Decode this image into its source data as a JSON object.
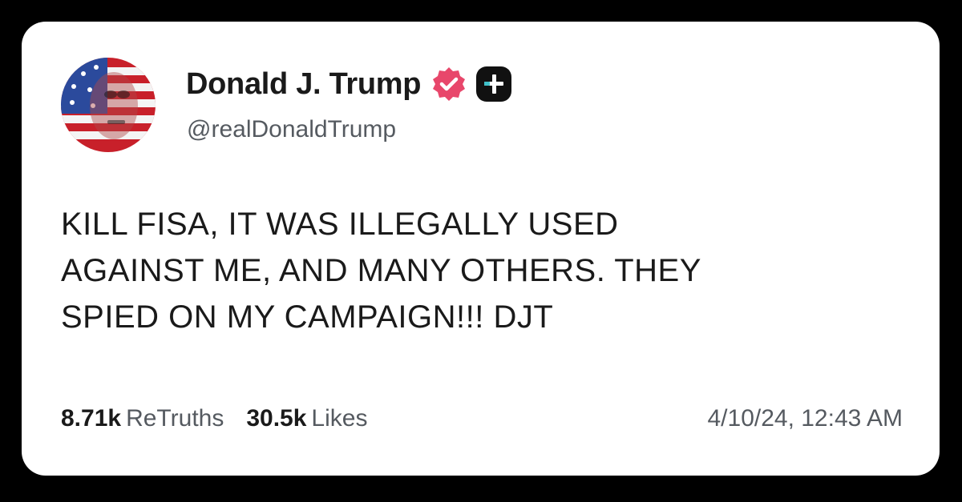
{
  "post": {
    "author": {
      "display_name": "Donald J. Trump",
      "handle": "@realDonaldTrump",
      "avatar_icon": "flag-portrait-avatar",
      "verified_icon": "verified-badge-icon",
      "plus_icon": "plus-badge-icon"
    },
    "text_lines": [
      "KILL FISA, IT WAS ILLEGALLY USED",
      "AGAINST ME, AND MANY OTHERS. THEY",
      "SPIED ON MY CAMPAIGN!!! DJT"
    ],
    "stats": {
      "retruths_count": "8.71k",
      "retruths_label": "ReTruths",
      "likes_count": "30.5k",
      "likes_label": "Likes"
    },
    "timestamp": "4/10/24, 12:43 AM"
  },
  "colors": {
    "background": "#000000",
    "card": "#ffffff",
    "text": "#1a1a1a",
    "muted": "#555a60",
    "verified": "#e8476b",
    "plus_badge": "#111111"
  }
}
